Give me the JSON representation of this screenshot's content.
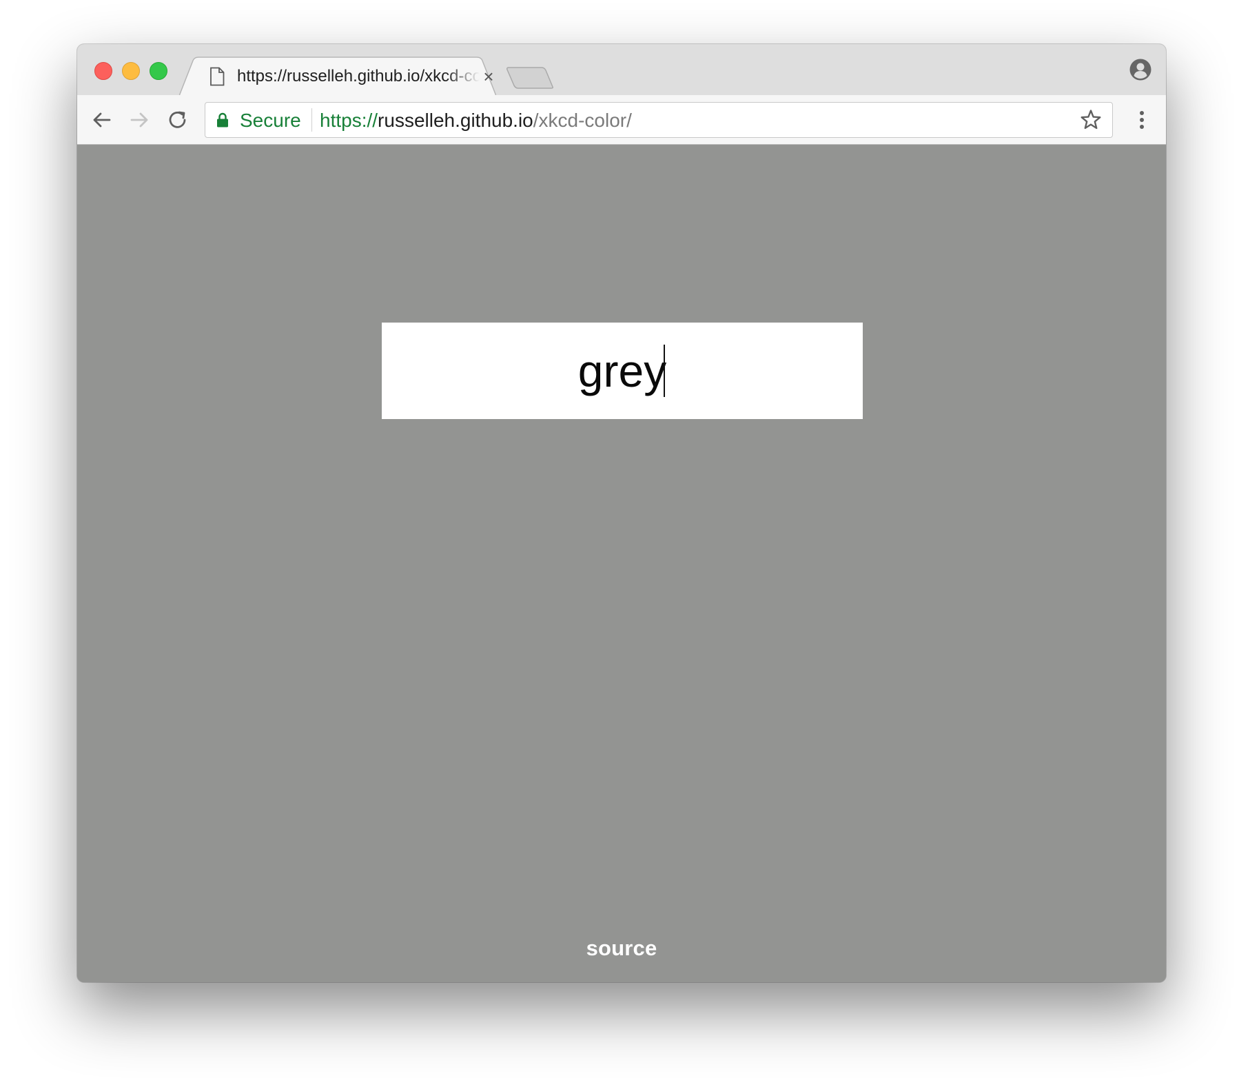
{
  "browser": {
    "tab": {
      "title": "https://russelleh.github.io/xkcd-color/",
      "close_glyph": "×"
    },
    "address_bar": {
      "security_label": "Secure",
      "url_scheme": "https://",
      "url_host": "russelleh.github.io",
      "url_path": "/xkcd-color/"
    },
    "icons": {
      "tab_icon": "page-icon",
      "back": "back-arrow-icon",
      "forward": "forward-arrow-icon",
      "reload": "reload-icon",
      "lock": "lock-icon",
      "bookmark": "star-icon",
      "menu": "kebab-menu-icon",
      "profile": "profile-icon"
    }
  },
  "page": {
    "background_color": "#939492",
    "color_input": {
      "value": "grey"
    },
    "footer_link": "source"
  },
  "colors": {
    "secure_green": "#188038",
    "page_background": "#939492",
    "input_background": "#ffffff",
    "link_color": "#ffffff"
  }
}
